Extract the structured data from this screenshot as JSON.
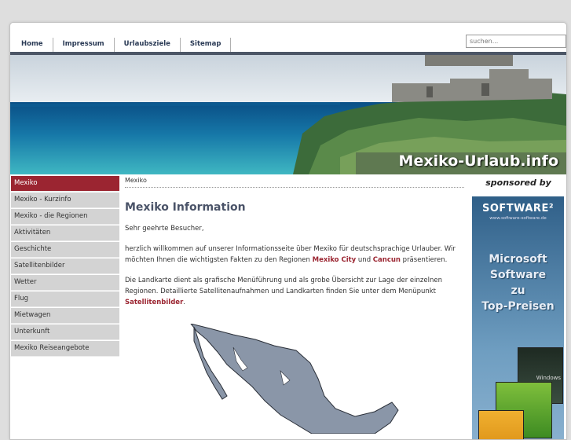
{
  "nav": {
    "items": [
      "Home",
      "Impressum",
      "Urlaubsziele",
      "Sitemap"
    ],
    "search_placeholder": "suchen..."
  },
  "banner": {
    "title": "Mexiko-Urlaub.info"
  },
  "sidebar": {
    "items": [
      "Mexiko",
      "Mexiko - Kurzinfo",
      "Mexiko - die Regionen",
      "Aktivitäten",
      "Geschichte",
      "Satellitenbilder",
      "Wetter",
      "Flug",
      "Mietwagen",
      "Unterkunft",
      "Mexiko Reiseangebote"
    ],
    "active_index": 0
  },
  "breadcrumb": "Mexiko",
  "content": {
    "title": "Mexiko Information",
    "greeting": "Sehr geehrte Besucher,",
    "p1_a": "herzlich willkommen auf unserer Informationsseite über Mexiko für deutschsprachige Urlauber. Wir möchten Ihnen die wichtigsten Fakten zu den Regionen ",
    "p1_link1": "Mexiko City",
    "p1_mid": " und ",
    "p1_link2": "Cancun",
    "p1_end": " präsentieren.",
    "p2_a": "Die Landkarte dient als grafische Menüführung und als grobe Übersicht zur Lage der einzelnen Regionen. Detaillierte Satellitenaufnahmen und Landkarten finden Sie unter dem Menüpunkt ",
    "p2_link": "Satellitenbilder",
    "p2_end": "."
  },
  "sponsor": {
    "label": "sponsored by",
    "logo": "SOFTWARE²",
    "sub": "www.software-software.de",
    "text": [
      "Microsoft",
      "Software",
      "zu",
      "Top-Preisen"
    ],
    "box_label": "Windows"
  },
  "colors": {
    "accent": "#9b2531",
    "nav_bar": "#4c5666",
    "heading": "#4a5368"
  }
}
